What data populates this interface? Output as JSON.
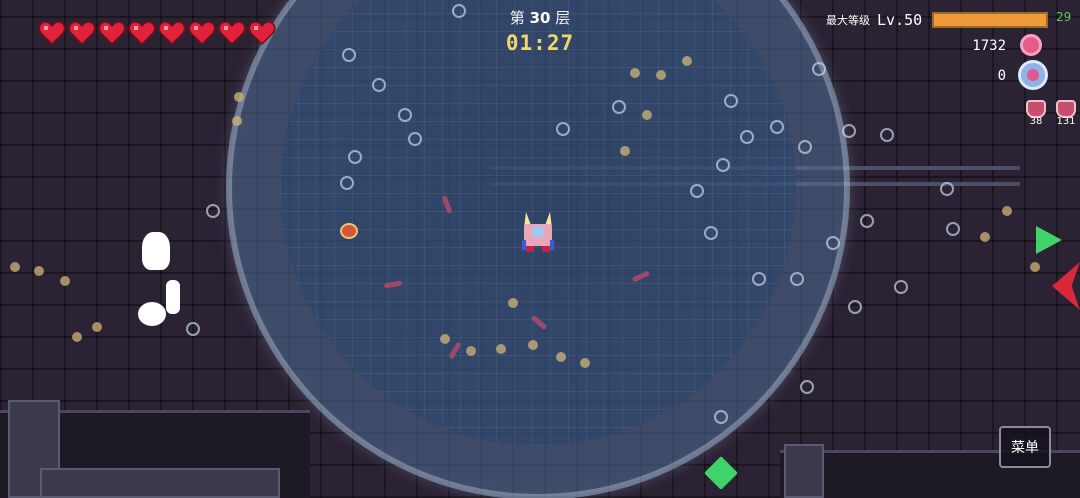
{
  "hud": {
    "hearts_count": 8,
    "heart_color": "#e0223a",
    "floor_prefix": "第",
    "floor_number": "30",
    "floor_suffix": "层",
    "timer": "01:27",
    "max_level_label": "最大等级",
    "level": "Lv.50",
    "xp_value": "29",
    "xp_fill_fraction": 1.0,
    "coins": "1732",
    "coin_icon": "donut-coin-icon",
    "gems": "0",
    "gem_icon": "orb-gem-icon",
    "potions": [
      {
        "icon": "potion-icon",
        "count": "38"
      },
      {
        "icon": "potion-icon",
        "count": "131"
      }
    ],
    "menu_label": "菜单"
  },
  "colors": {
    "timer": "#f3d76a",
    "xp_bar": "#ef9b3a",
    "xp_text": "#5ec85a",
    "arrow": "#3ed46a",
    "bubble": "#7fa6cf"
  }
}
